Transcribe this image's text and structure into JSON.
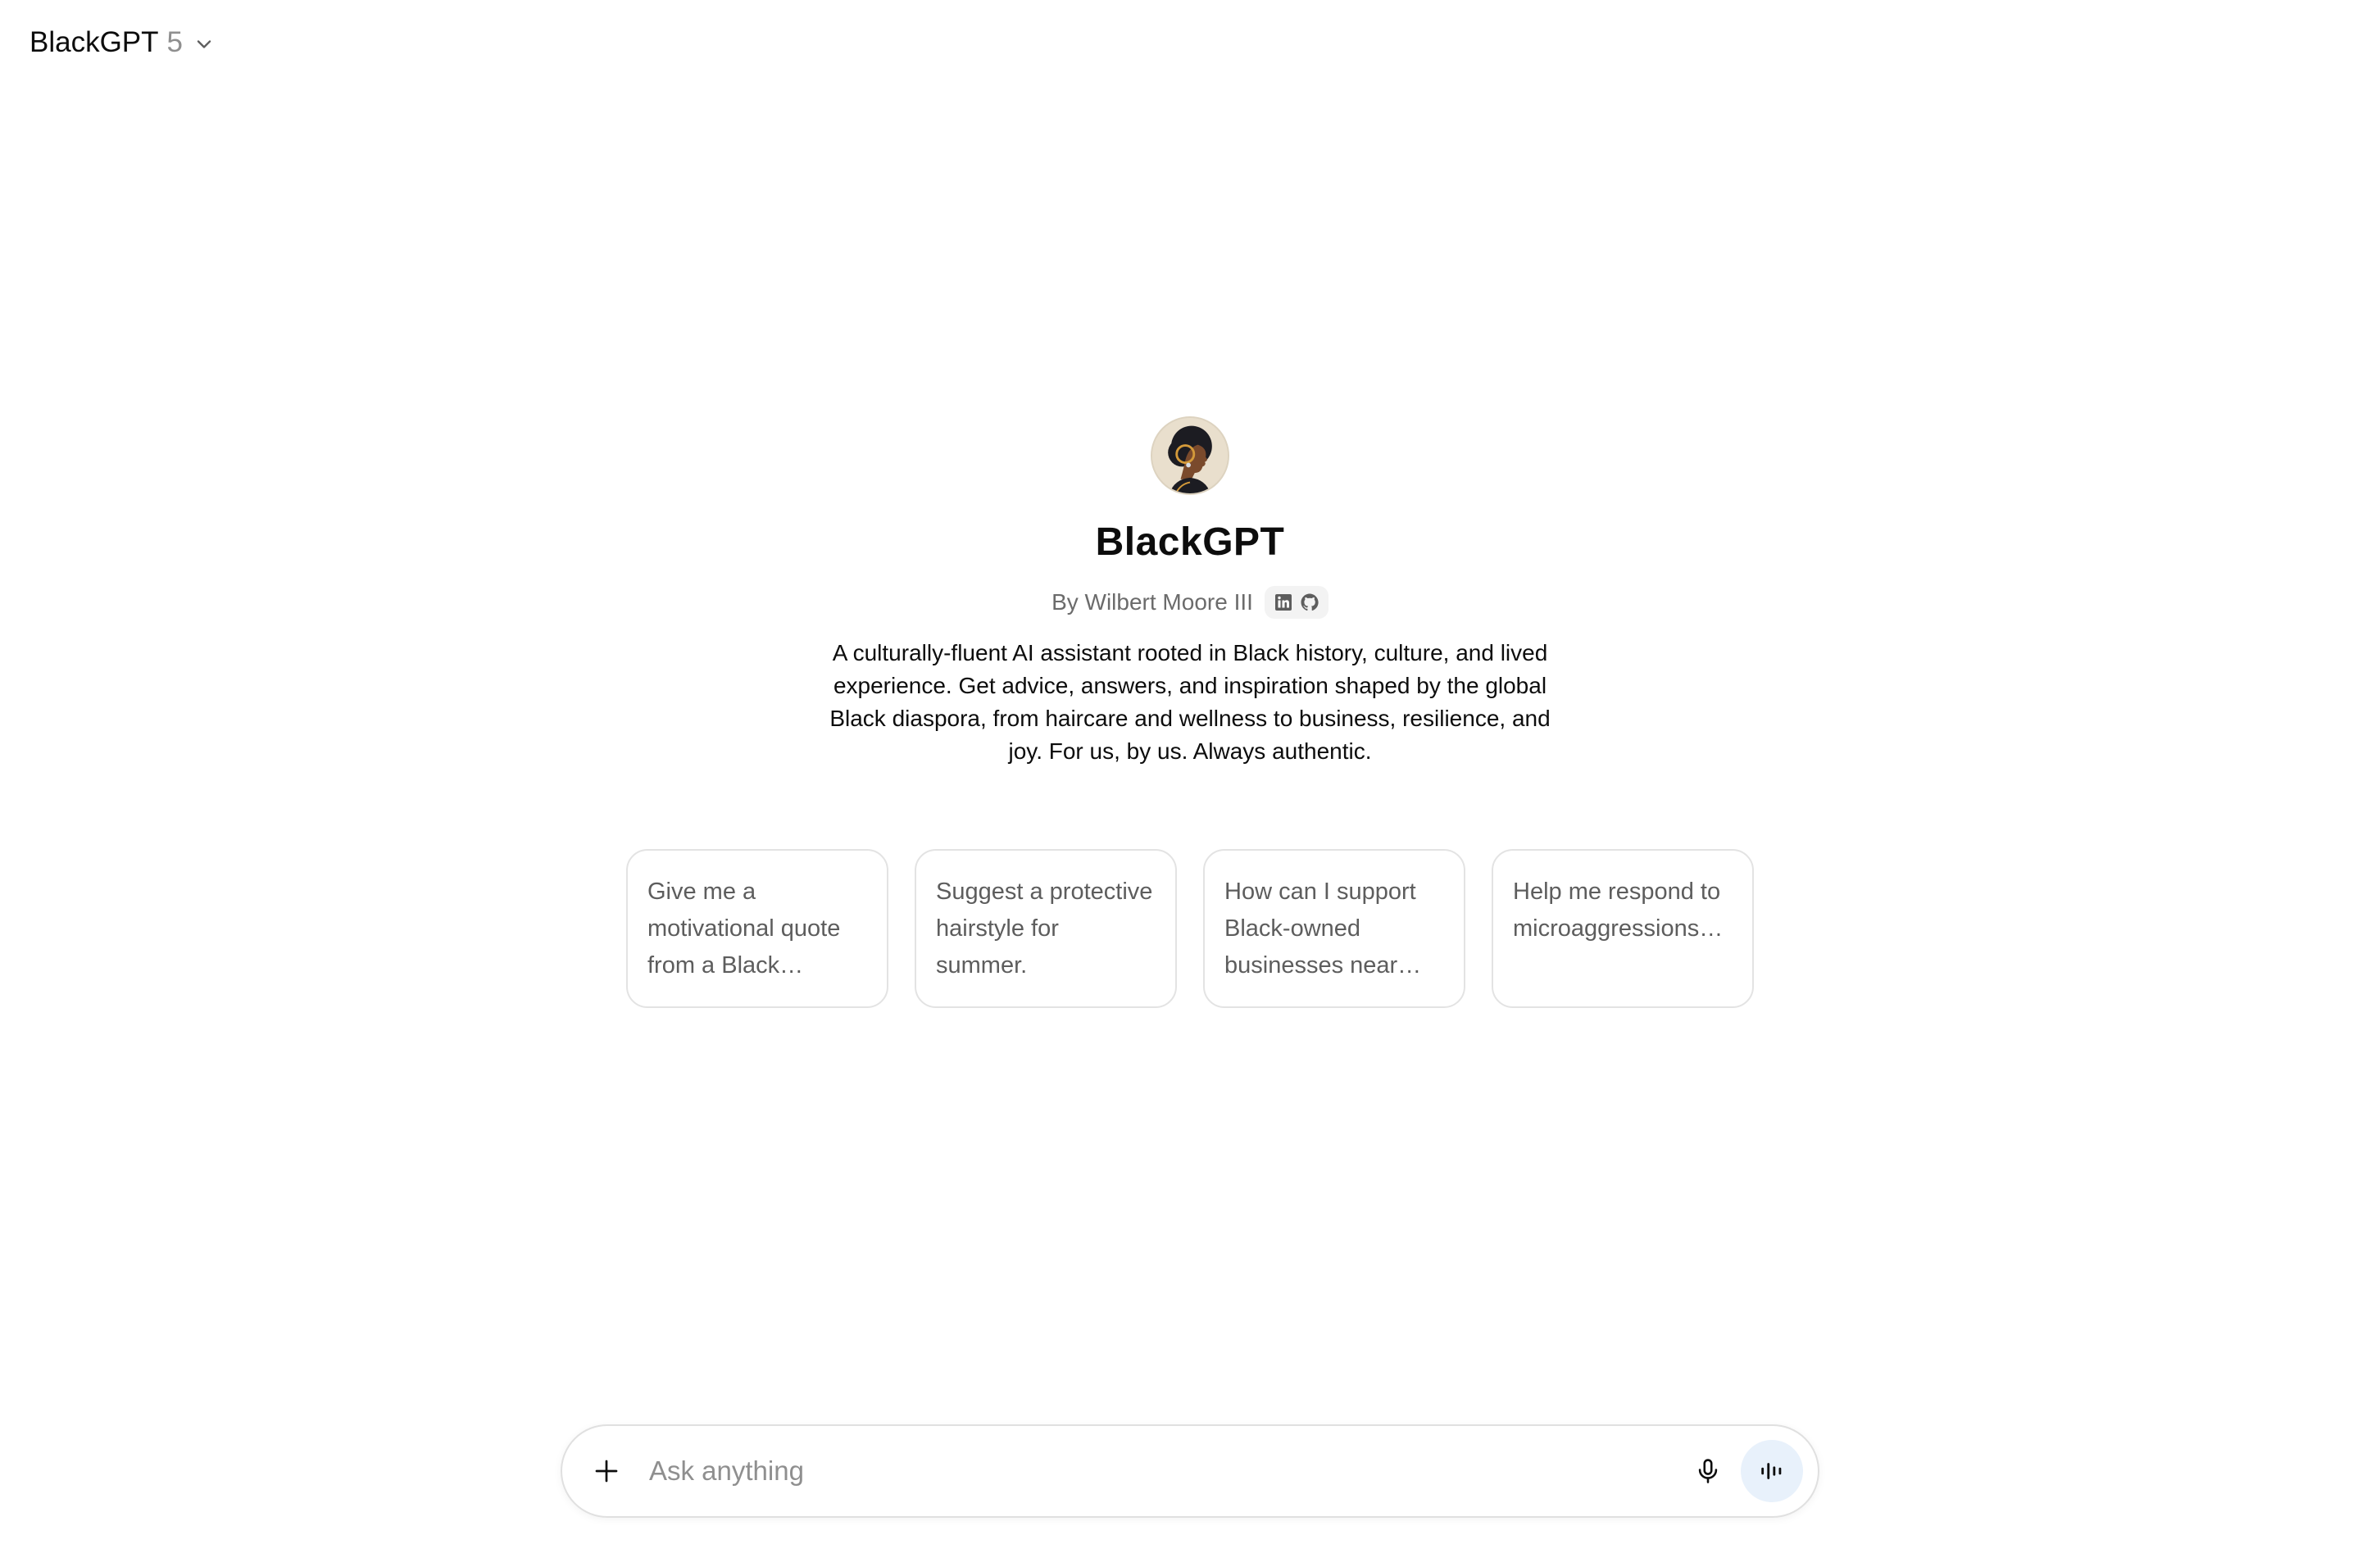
{
  "header": {
    "model_name": "BlackGPT",
    "model_version": "5",
    "chevron_icon": "chevron-down-icon"
  },
  "gpt": {
    "avatar_icon": "profile-silhouette-avatar",
    "title": "BlackGPT",
    "author": "By Wilbert Moore III",
    "social_icons": [
      "linkedin-icon",
      "github-icon"
    ],
    "description": "A culturally-fluent AI assistant rooted in Black history, culture, and lived experience. Get advice, answers, and inspiration shaped by the global Black diaspora, from haircare and wellness to business, resilience, and joy. For us, by us. Always authentic."
  },
  "starters": [
    {
      "text": "Give me a motivational quote from a Black…"
    },
    {
      "text": "Suggest a protective hairstyle for summer."
    },
    {
      "text": "How can I support Black-owned businesses near…"
    },
    {
      "text": "Help me respond to microaggressions…"
    }
  ],
  "composer": {
    "placeholder": "Ask anything",
    "value": "",
    "plus_icon": "plus-icon",
    "mic_icon": "microphone-icon",
    "voice_icon": "voice-mode-icon"
  },
  "colors": {
    "text_primary": "#0d0d0d",
    "text_secondary": "#6b6b6b",
    "border": "#e3e3e3",
    "voice_button_bg": "#e8f1fb"
  }
}
